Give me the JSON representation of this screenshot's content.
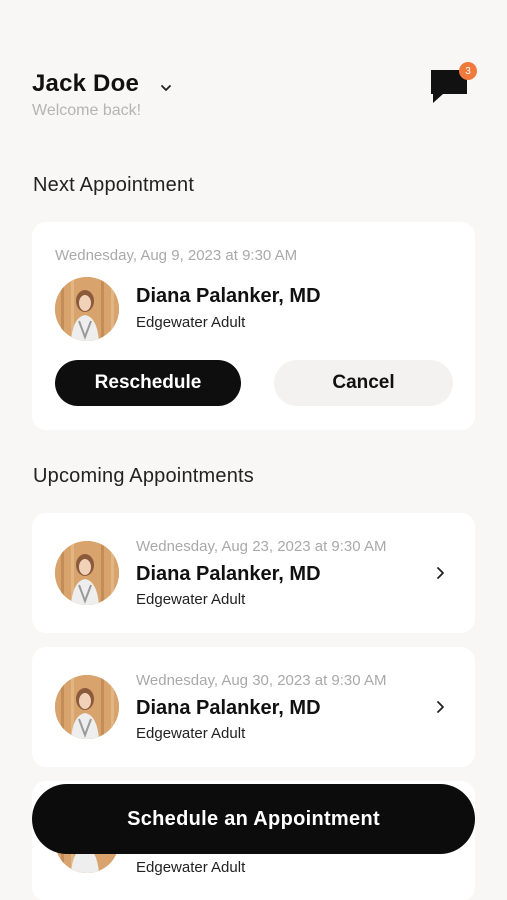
{
  "header": {
    "user_name": "Jack Doe",
    "welcome": "Welcome back!",
    "chat_badge": "3"
  },
  "next_section": {
    "title": "Next Appointment",
    "date": "Wednesday, Aug 9, 2023 at 9:30 AM",
    "doctor": "Diana Palanker, MD",
    "location": "Edgewater Adult",
    "reschedule_label": "Reschedule",
    "cancel_label": "Cancel"
  },
  "upcoming_section": {
    "title": "Upcoming Appointments",
    "items": [
      {
        "date": "Wednesday, Aug 23, 2023 at 9:30 AM",
        "doctor": "Diana Palanker, MD",
        "location": "Edgewater Adult"
      },
      {
        "date": "Wednesday, Aug 30, 2023 at 9:30 AM",
        "doctor": "Diana Palanker, MD",
        "location": "Edgewater Adult"
      },
      {
        "location": "Edgewater Adult"
      }
    ]
  },
  "schedule_label": "Schedule an Appointment",
  "colors": {
    "accent_badge": "#f07a3b",
    "primary_button": "#0e0e0e",
    "background": "#f8f7f5"
  }
}
